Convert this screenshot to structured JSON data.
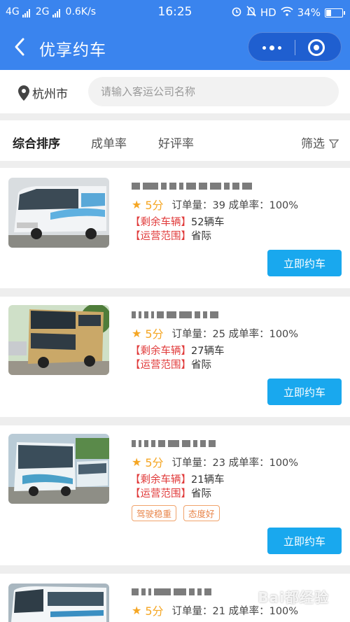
{
  "status_bar": {
    "network1": "4G",
    "network2": "2G",
    "speed": "0.6K/s",
    "time": "16:25",
    "hd": "HD",
    "battery": "34%",
    "battery_level": 0.34
  },
  "titlebar": {
    "title": "优享约车",
    "back_icon": "chevron-left-icon",
    "menu_icon": "more-dots-icon",
    "close_icon": "target-circle-icon"
  },
  "search": {
    "city": "杭州市",
    "placeholder": "请输入客运公司名称"
  },
  "sort": {
    "tabs": [
      {
        "label": "综合排序",
        "active": true
      },
      {
        "label": "成单率",
        "active": false
      },
      {
        "label": "好评率",
        "active": false
      }
    ],
    "filter_label": "筛选"
  },
  "colors": {
    "header": "#3a84ee",
    "button": "#19a8ee",
    "star": "#f5a623",
    "label_red": "#e03a3a",
    "tag_orange": "#e8854a"
  },
  "listings": [
    {
      "score": "5分",
      "metrics": "订单量：39 成单率：100%",
      "vehicles_label": "【剩余车辆】",
      "vehicles_value": "52辆车",
      "scope_label": "【运营范围】",
      "scope_value": "省际",
      "tags": [],
      "button": "立即约车"
    },
    {
      "score": "5分",
      "metrics": "订单量：25 成单率：100%",
      "vehicles_label": "【剩余车辆】",
      "vehicles_value": "27辆车",
      "scope_label": "【运营范围】",
      "scope_value": "省际",
      "tags": [],
      "button": "立即约车"
    },
    {
      "score": "5分",
      "metrics": "订单量：23 成单率：100%",
      "vehicles_label": "【剩余车辆】",
      "vehicles_value": "21辆车",
      "scope_label": "【运营范围】",
      "scope_value": "省际",
      "tags": [
        "驾驶稳重",
        "态度好"
      ],
      "button": "立即约车"
    },
    {
      "score": "5分",
      "metrics": "订单量：21 成单率：100%",
      "tags": []
    }
  ],
  "watermark": "Bai都经验"
}
